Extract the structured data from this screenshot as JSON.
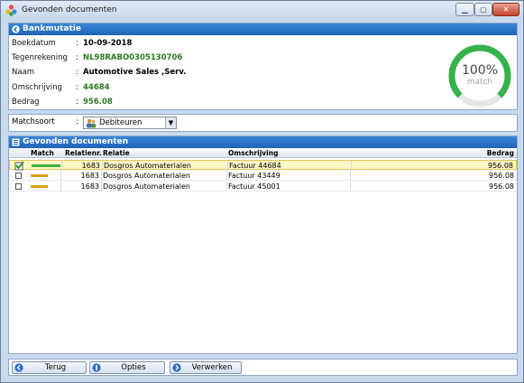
{
  "window": {
    "title": "Gevonden documenten",
    "min_icon": "minimize-icon",
    "max_icon": "maximize-icon",
    "close_icon": "close-icon",
    "min_glyph": "▁",
    "max_glyph": "▢",
    "close_glyph": "✕"
  },
  "bank": {
    "header": "Bankmutatie",
    "fields": [
      {
        "label": "Boekdatum",
        "colon": ":",
        "value": "10-09-2018",
        "color": "#000000"
      },
      {
        "label": "Tegenrekening",
        "colon": ":",
        "value": "NL98RABO0305130706",
        "color": "#2a7a1f"
      },
      {
        "label": "Naam",
        "colon": ":",
        "value": "Automotive Sales ,Serv.",
        "color": "#000000"
      },
      {
        "label": "Omschrijving",
        "colon": ":",
        "value": "44684",
        "color": "#2a7a1f"
      },
      {
        "label": "Bedrag",
        "colon": ":",
        "value": "956.08",
        "color": "#2a7a1f"
      }
    ],
    "gauge": {
      "percent_text": "100%",
      "label": "match",
      "value": 1.0,
      "color": "#35b24a"
    }
  },
  "matchsoort": {
    "label": "Matchsoort",
    "colon": ":",
    "selected": "Debiteuren"
  },
  "documents": {
    "header": "Gevonden documenten",
    "columns": [
      "Match",
      "Relatienr.",
      "Relatie",
      "Omschrijving",
      "Bedrag"
    ],
    "rows": [
      {
        "checked": true,
        "match_level": 1.0,
        "match_color": "#3db43b",
        "relatienr": "1683",
        "relatie": "Dosgros Automaterialen",
        "omschrijving": "Factuur 44684",
        "bedrag": "956.08"
      },
      {
        "checked": false,
        "match_level": 0.6,
        "match_color": "#d8a21c",
        "relatienr": "1683",
        "relatie": "Dosgros Automaterialen",
        "omschrijving": "Factuur 43449",
        "bedrag": "956.08"
      },
      {
        "checked": false,
        "match_level": 0.6,
        "match_color": "#d8a21c",
        "relatienr": "1683",
        "relatie": "Dosgros Automaterialen",
        "omschrijving": "Factuur 45001",
        "bedrag": "956.08"
      }
    ]
  },
  "buttons": {
    "back": "Terug",
    "options": "Opties",
    "process": "Verwerken"
  },
  "colors": {
    "accent": "#1f63b7",
    "selected_row": "#fff6c6"
  }
}
